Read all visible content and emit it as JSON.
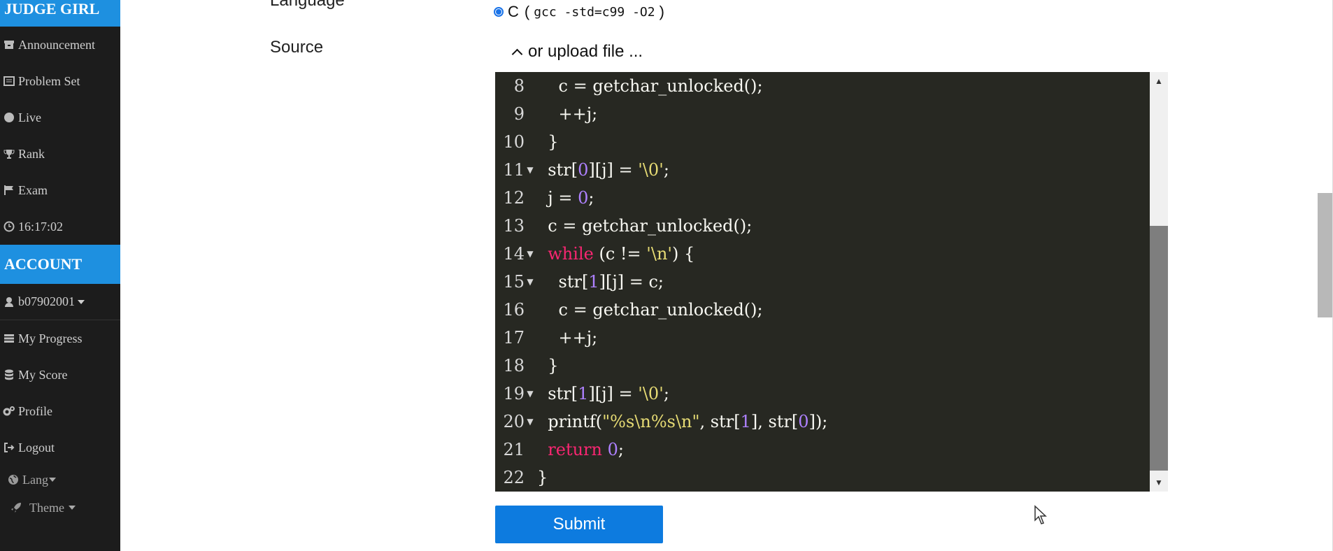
{
  "sidebar": {
    "brand": "JUDGE GIRL",
    "items": [
      {
        "label": "Announcement",
        "icon": "archive-icon"
      },
      {
        "label": "Problem Set",
        "icon": "list-icon"
      },
      {
        "label": "Live",
        "icon": "circle-icon"
      },
      {
        "label": "Rank",
        "icon": "trophy-icon"
      },
      {
        "label": "Exam",
        "icon": "flag-icon"
      },
      {
        "label": "16:17:02",
        "icon": "clock-icon"
      }
    ],
    "account_header": "ACCOUNT",
    "account_items": [
      {
        "label": "b07902001",
        "icon": "user-icon"
      },
      {
        "label": "My Progress",
        "icon": "tasks-icon"
      },
      {
        "label": "My Score",
        "icon": "database-icon"
      },
      {
        "label": "Profile",
        "icon": "gears-icon"
      },
      {
        "label": "Logout",
        "icon": "sign-out-icon"
      }
    ],
    "lang": "Lang",
    "theme": "Theme"
  },
  "form": {
    "language_label": "Language",
    "language_option": "C",
    "language_paren_open": "(",
    "language_cmd": "gcc -std=c99 -O2",
    "language_paren_close": ")",
    "source_label": "Source",
    "upload_toggle": "or upload file ...",
    "submit_label": "Submit"
  },
  "editor": {
    "lines": [
      {
        "n": "8",
        "fold": "",
        "tokens": [
          [
            "",
            "    c = getchar_unlocked();"
          ]
        ]
      },
      {
        "n": "9",
        "fold": "",
        "tokens": [
          [
            "",
            "    ++j;"
          ]
        ]
      },
      {
        "n": "10",
        "fold": "",
        "tokens": [
          [
            "",
            "  }"
          ]
        ]
      },
      {
        "n": "11",
        "fold": "▼",
        "tokens": [
          [
            "",
            "  str["
          ],
          [
            "num",
            "0"
          ],
          [
            "",
            "][j] = "
          ],
          [
            "str",
            "'\\0'"
          ],
          [
            "",
            ";"
          ]
        ]
      },
      {
        "n": "12",
        "fold": "",
        "tokens": [
          [
            "",
            "  j = "
          ],
          [
            "num",
            "0"
          ],
          [
            "",
            ";"
          ]
        ]
      },
      {
        "n": "13",
        "fold": "",
        "tokens": [
          [
            "",
            "  c = getchar_unlocked();"
          ]
        ]
      },
      {
        "n": "14",
        "fold": "▼",
        "tokens": [
          [
            "",
            "  "
          ],
          [
            "kw",
            "while"
          ],
          [
            "",
            " (c != "
          ],
          [
            "str",
            "'\\n'"
          ],
          [
            "",
            ") {"
          ]
        ]
      },
      {
        "n": "15",
        "fold": "▼",
        "tokens": [
          [
            "",
            "    str["
          ],
          [
            "num",
            "1"
          ],
          [
            "",
            "][j] = c;"
          ]
        ]
      },
      {
        "n": "16",
        "fold": "",
        "tokens": [
          [
            "",
            "    c = getchar_unlocked();"
          ]
        ]
      },
      {
        "n": "17",
        "fold": "",
        "tokens": [
          [
            "",
            "    ++j;"
          ]
        ]
      },
      {
        "n": "18",
        "fold": "",
        "tokens": [
          [
            "",
            "  }"
          ]
        ]
      },
      {
        "n": "19",
        "fold": "▼",
        "tokens": [
          [
            "",
            "  str["
          ],
          [
            "num",
            "1"
          ],
          [
            "",
            "][j] = "
          ],
          [
            "str",
            "'\\0'"
          ],
          [
            "",
            ";"
          ]
        ]
      },
      {
        "n": "20",
        "fold": "▼",
        "tokens": [
          [
            "",
            "  printf("
          ],
          [
            "str",
            "\"%s\\n%s\\n\""
          ],
          [
            "",
            ", str["
          ],
          [
            "num",
            "1"
          ],
          [
            "",
            "], str["
          ],
          [
            "num",
            "0"
          ],
          [
            "",
            "]);"
          ]
        ]
      },
      {
        "n": "21",
        "fold": "",
        "tokens": [
          [
            "",
            "  "
          ],
          [
            "kw",
            "return"
          ],
          [
            "",
            " "
          ],
          [
            "num",
            "0"
          ],
          [
            "",
            ";"
          ]
        ]
      },
      {
        "n": "22",
        "fold": "",
        "tokens": [
          [
            "",
            "}"
          ]
        ]
      }
    ]
  }
}
